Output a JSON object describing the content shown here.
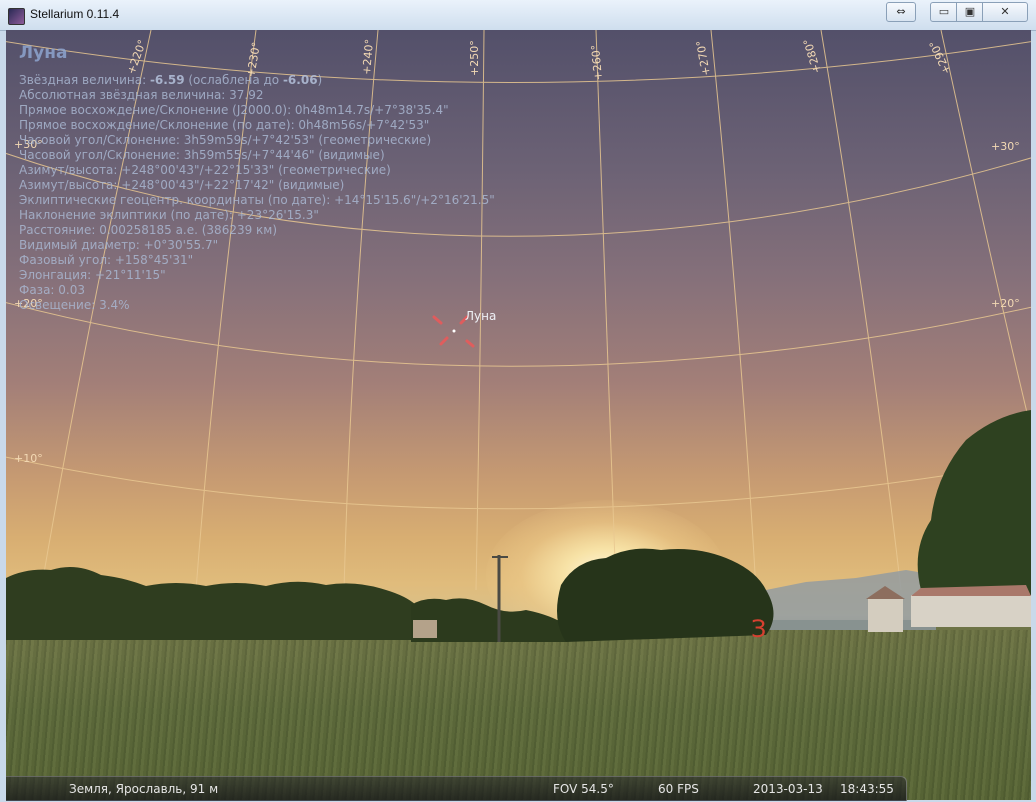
{
  "window": {
    "title": "Stellarium 0.11.4",
    "buttons": {
      "swap": "⇔",
      "minimize": "▭",
      "maximize": "▣",
      "close": "✕"
    }
  },
  "info": {
    "object_name": "Луна",
    "magnitude_label": "Звёздная величина:",
    "magnitude_value": "-6.59",
    "magnitude_note_a": "(ослаблена до",
    "magnitude_dimmed": "-6.06",
    "magnitude_note_b": ")",
    "lines": [
      "Абсолютная звёздная величина: 37.92",
      "Прямое восхождение/Склонение (J2000.0): 0h48m14.7s/+7°38'35.4\"",
      "Прямое восхождение/Склонение (по дате): 0h48m56s/+7°42'53\"",
      "Часовой угол/Склонение: 3h59m59s/+7°42'53\" (геометрические)",
      "Часовой угол/Склонение: 3h59m55s/+7°44'46\" (видимые)",
      "Азимут/высота: +248°00'43\"/+22°15'33\" (геометрические)",
      "Азимут/высота: +248°00'43\"/+22°17'42\" (видимые)",
      "Эклиптические геоцентр. координаты (по дате): +14°15'15.6\"/+2°16'21.5\"",
      "Наклонение эклиптики (по дате): +23°26'15.3\"",
      "Расстояние: 0.00258185 а.е. (386239 км)",
      "Видимый диаметр: +0°30'55.7\"",
      "Фазовый угол: +158°45'31\"",
      "Элонгация: +21°11'15\"",
      "Фаза: 0.03",
      "Освещение: 3.4%"
    ]
  },
  "sky": {
    "moon_label": "Луна",
    "cardinal": "З",
    "azimuth_labels": [
      "+220°",
      "+230°",
      "+240°",
      "+250°",
      "+260°",
      "+270°",
      "+280°",
      "+290°"
    ],
    "altitude_labels": [
      "+30°",
      "+20°",
      "+10°"
    ]
  },
  "status": {
    "location": "Земля, Ярославль, 91 м",
    "fov": "FOV 54.5°",
    "fps": "60 FPS",
    "date": "2013-03-13",
    "time": "18:43:55"
  },
  "colors": {
    "grid": "#e9c891",
    "info_text": "#a9b7d1",
    "cardinal": "#d64030",
    "moon_marker": "#e85a5a"
  }
}
